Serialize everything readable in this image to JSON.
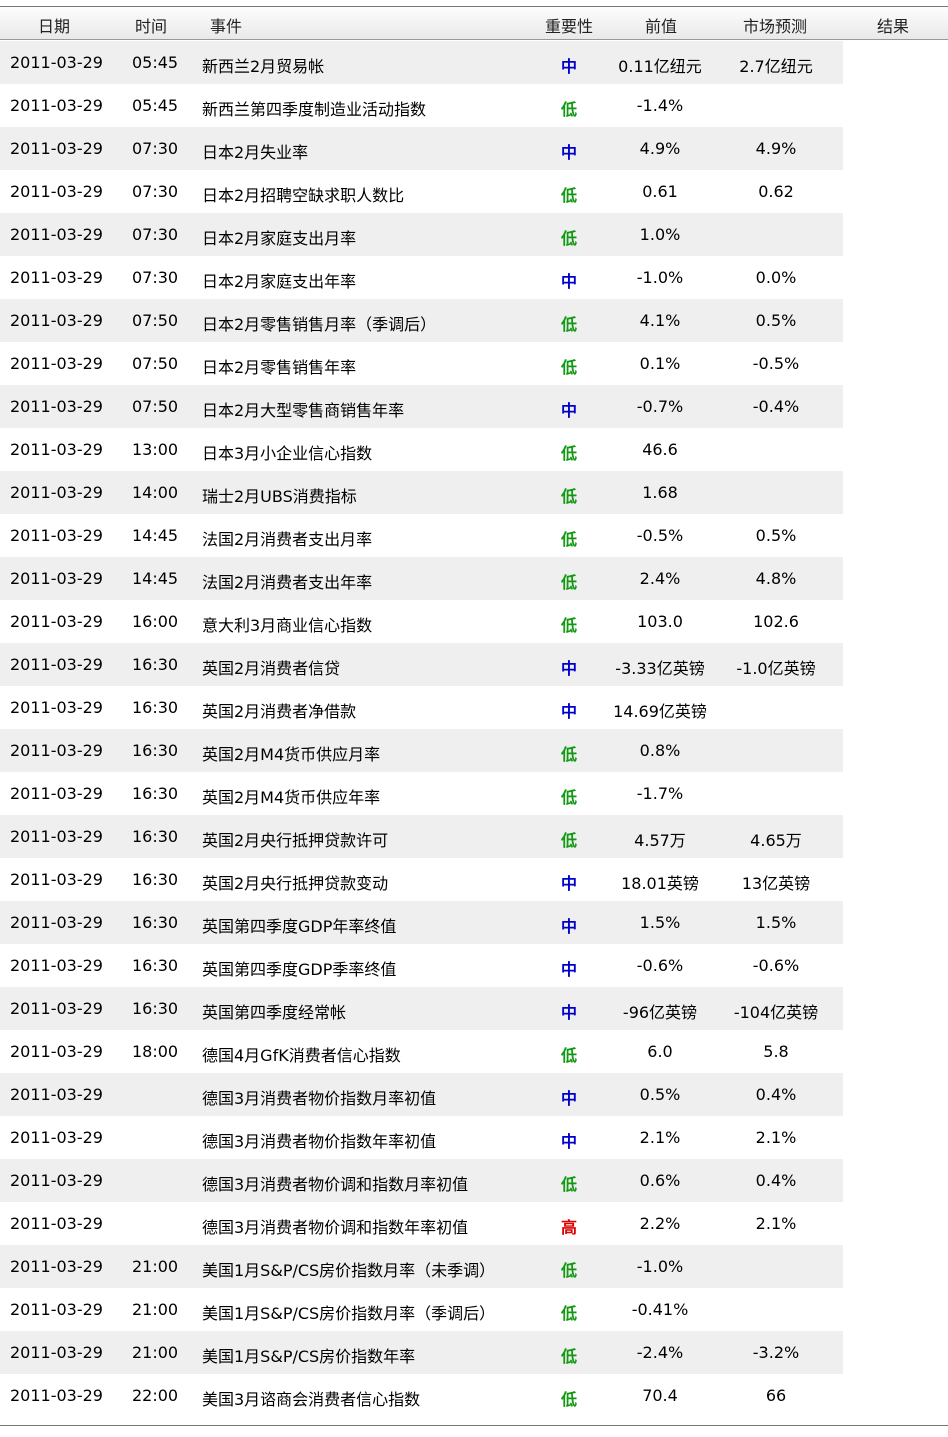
{
  "header": {
    "date": "日期",
    "time": "时间",
    "event": "事件",
    "importance": "重要性",
    "previous": "前值",
    "forecast": "市场预测",
    "result": "结果"
  },
  "colors": {
    "mid": "#0000cc",
    "low": "#119911",
    "high": "#dd0000"
  },
  "rows": [
    {
      "date": "2011-03-29",
      "time": "05:45",
      "event": "新西兰2月贸易帐",
      "importance": "中",
      "previous": "0.11亿纽元",
      "forecast": "2.7亿纽元"
    },
    {
      "date": "2011-03-29",
      "time": "05:45",
      "event": "新西兰第四季度制造业活动指数",
      "importance": "低",
      "previous": "-1.4%",
      "forecast": ""
    },
    {
      "date": "2011-03-29",
      "time": "07:30",
      "event": "日本2月失业率",
      "importance": "中",
      "previous": "4.9%",
      "forecast": "4.9%"
    },
    {
      "date": "2011-03-29",
      "time": "07:30",
      "event": "日本2月招聘空缺求职人数比",
      "importance": "低",
      "previous": "0.61",
      "forecast": "0.62"
    },
    {
      "date": "2011-03-29",
      "time": "07:30",
      "event": "日本2月家庭支出月率",
      "importance": "低",
      "previous": "1.0%",
      "forecast": ""
    },
    {
      "date": "2011-03-29",
      "time": "07:30",
      "event": "日本2月家庭支出年率",
      "importance": "中",
      "previous": "-1.0%",
      "forecast": "0.0%"
    },
    {
      "date": "2011-03-29",
      "time": "07:50",
      "event": "日本2月零售销售月率（季调后）",
      "importance": "低",
      "previous": "4.1%",
      "forecast": "0.5%"
    },
    {
      "date": "2011-03-29",
      "time": "07:50",
      "event": "日本2月零售销售年率",
      "importance": "低",
      "previous": "0.1%",
      "forecast": "-0.5%"
    },
    {
      "date": "2011-03-29",
      "time": "07:50",
      "event": "日本2月大型零售商销售年率",
      "importance": "中",
      "previous": "-0.7%",
      "forecast": "-0.4%"
    },
    {
      "date": "2011-03-29",
      "time": "13:00",
      "event": "日本3月小企业信心指数",
      "importance": "低",
      "previous": "46.6",
      "forecast": ""
    },
    {
      "date": "2011-03-29",
      "time": "14:00",
      "event": "瑞士2月UBS消费指标",
      "importance": "低",
      "previous": "1.68",
      "forecast": ""
    },
    {
      "date": "2011-03-29",
      "time": "14:45",
      "event": "法国2月消费者支出月率",
      "importance": "低",
      "previous": "-0.5%",
      "forecast": "0.5%"
    },
    {
      "date": "2011-03-29",
      "time": "14:45",
      "event": "法国2月消费者支出年率",
      "importance": "低",
      "previous": "2.4%",
      "forecast": "4.8%"
    },
    {
      "date": "2011-03-29",
      "time": "16:00",
      "event": "意大利3月商业信心指数",
      "importance": "低",
      "previous": "103.0",
      "forecast": "102.6"
    },
    {
      "date": "2011-03-29",
      "time": "16:30",
      "event": "英国2月消费者信贷",
      "importance": "中",
      "previous": "-3.33亿英镑",
      "forecast": "-1.0亿英镑"
    },
    {
      "date": "2011-03-29",
      "time": "16:30",
      "event": "英国2月消费者净借款",
      "importance": "中",
      "previous": "14.69亿英镑",
      "forecast": ""
    },
    {
      "date": "2011-03-29",
      "time": "16:30",
      "event": "英国2月M4货币供应月率",
      "importance": "低",
      "previous": "0.8%",
      "forecast": ""
    },
    {
      "date": "2011-03-29",
      "time": "16:30",
      "event": "英国2月M4货币供应年率",
      "importance": "低",
      "previous": "-1.7%",
      "forecast": ""
    },
    {
      "date": "2011-03-29",
      "time": "16:30",
      "event": "英国2月央行抵押贷款许可",
      "importance": "低",
      "previous": "4.57万",
      "forecast": "4.65万"
    },
    {
      "date": "2011-03-29",
      "time": "16:30",
      "event": "英国2月央行抵押贷款变动",
      "importance": "中",
      "previous": "18.01英镑",
      "forecast": "13亿英镑"
    },
    {
      "date": "2011-03-29",
      "time": "16:30",
      "event": "英国第四季度GDP年率终值",
      "importance": "中",
      "previous": "1.5%",
      "forecast": "1.5%"
    },
    {
      "date": "2011-03-29",
      "time": "16:30",
      "event": "英国第四季度GDP季率终值",
      "importance": "中",
      "previous": "-0.6%",
      "forecast": "-0.6%"
    },
    {
      "date": "2011-03-29",
      "time": "16:30",
      "event": "英国第四季度经常帐",
      "importance": "中",
      "previous": "-96亿英镑",
      "forecast": "-104亿英镑"
    },
    {
      "date": "2011-03-29",
      "time": "18:00",
      "event": "德国4月GfK消费者信心指数",
      "importance": "低",
      "previous": "6.0",
      "forecast": "5.8"
    },
    {
      "date": "2011-03-29",
      "time": "",
      "event": "德国3月消费者物价指数月率初值",
      "importance": "中",
      "previous": "0.5%",
      "forecast": "0.4%"
    },
    {
      "date": "2011-03-29",
      "time": "",
      "event": "德国3月消费者物价指数年率初值",
      "importance": "中",
      "previous": "2.1%",
      "forecast": "2.1%"
    },
    {
      "date": "2011-03-29",
      "time": "",
      "event": "德国3月消费者物价调和指数月率初值",
      "importance": "低",
      "previous": "0.6%",
      "forecast": "0.4%"
    },
    {
      "date": "2011-03-29",
      "time": "",
      "event": "德国3月消费者物价调和指数年率初值",
      "importance": "高",
      "previous": "2.2%",
      "forecast": "2.1%"
    },
    {
      "date": "2011-03-29",
      "time": "21:00",
      "event": "美国1月S&P/CS房价指数月率（未季调）",
      "importance": "低",
      "previous": "-1.0%",
      "forecast": ""
    },
    {
      "date": "2011-03-29",
      "time": "21:00",
      "event": "美国1月S&P/CS房价指数月率（季调后）",
      "importance": "低",
      "previous": "-0.41%",
      "forecast": ""
    },
    {
      "date": "2011-03-29",
      "time": "21:00",
      "event": "美国1月S&P/CS房价指数年率",
      "importance": "低",
      "previous": "-2.4%",
      "forecast": "-3.2%"
    },
    {
      "date": "2011-03-29",
      "time": "22:00",
      "event": "美国3月谘商会消费者信心指数",
      "importance": "低",
      "previous": "70.4",
      "forecast": "66"
    }
  ]
}
